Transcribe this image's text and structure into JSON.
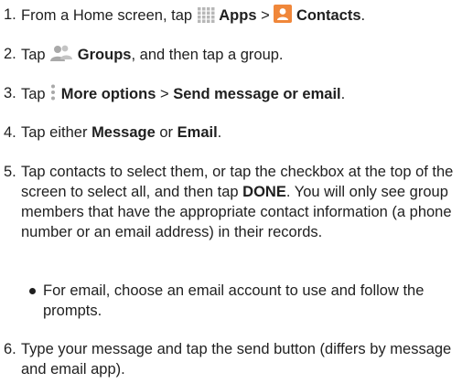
{
  "steps": [
    {
      "number": "1.",
      "parts": {
        "a": "From a Home screen, tap",
        "apps_label": "Apps",
        "sep": ">",
        "contacts_label": "Contacts",
        "end": "."
      },
      "icons": [
        "apps-grid-icon",
        "contacts-icon"
      ]
    },
    {
      "number": "2.",
      "parts": {
        "a": "Tap",
        "groups_label": "Groups",
        "b": ", and then tap a group."
      },
      "icons": [
        "groups-icon"
      ]
    },
    {
      "number": "3.",
      "parts": {
        "a": "Tap",
        "more_label": "More options",
        "sep": ">",
        "send_label": "Send message or email",
        "end": "."
      },
      "icons": [
        "more-options-icon"
      ]
    },
    {
      "number": "4.",
      "parts": {
        "a": "Tap either",
        "message_label": "Message",
        "b": "or",
        "email_label": "Email",
        "end": "."
      }
    },
    {
      "number": "5.",
      "parts": {
        "a": "Tap contacts to select them, or tap the checkbox at the top of the screen to select all, and then tap",
        "done_label": "DONE",
        "b": ". You will only see group members that have the appropriate contact information (a phone number or an email address) in their records."
      },
      "bullet": "For email, choose an email account to use and follow the prompts."
    },
    {
      "number": "6.",
      "parts": {
        "a": "Type your message and tap the send button (differs by message and email app)."
      }
    }
  ],
  "colors": {
    "text": "#1f1f1f",
    "contacts_icon_bg": "#f0873a",
    "apps_icon": "#b7b7b7",
    "groups_icon": "#a9a9a9"
  }
}
